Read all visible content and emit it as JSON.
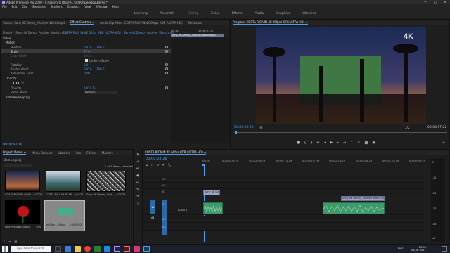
{
  "window": {
    "title": "Adobe Premiere Pro 2020 - C:\\Users\\FR DIGITAL SUTRA\\Desktop\\Demo *",
    "controls": [
      "—",
      "□",
      "✕"
    ]
  },
  "menu": [
    "File",
    "Edit",
    "Clip",
    "Sequence",
    "Markers",
    "Graphics",
    "View",
    "Window",
    "Help"
  ],
  "workspaces": {
    "items": [
      "Learning",
      "Assembly",
      "Editing",
      "Color",
      "Effects",
      "Audio",
      "Graphics",
      "Libraries"
    ],
    "active": "Editing"
  },
  "source_header": {
    "tabs": [
      "Source: Sony 4K Demo_ Another World.mp4",
      "Effect Controls ≡",
      "Audio Clip Mixer: COSTA RICA IN 4K 60fps HDR (ULTRA HD)",
      "Metadata"
    ]
  },
  "effect_controls": {
    "master": "Master * Sony 4K Demo_ Another World.mp4",
    "clip": "COSTA RICA IN 4K 60fps HDR (ULTRA HD) * Sony 4K Demo_ Another World.mp4",
    "timecode_start": "00:00",
    "timecode_end": "00:00:12:0",
    "clip_bar": "Sony 4K Demo_ Another World.mp4",
    "video_label": "Video",
    "motion": "Motion",
    "position_label": "Position",
    "position_x": "640.0",
    "position_y": "360.0",
    "scale_label": "Scale",
    "scale_value": "97.0",
    "scale_width_label": "Scale Width",
    "scale_width_value": "100.0",
    "uniform_label": "Uniform Scale",
    "rotation_label": "Rotation",
    "rotation_value": "0.0",
    "anchor_label": "Anchor Point",
    "anchor_x": "640.0",
    "anchor_y": "360.0",
    "flicker_label": "Anti-flicker Filter",
    "flicker_value": "0.00",
    "opacity": "Opacity",
    "opacity_label": "Opacity",
    "opacity_value": "100.0 %",
    "blend_label": "Blend Mode",
    "blend_value": "Normal",
    "time_remap": "Time Remapping",
    "timecode_bottom": "00:00:03:26"
  },
  "program": {
    "title": "Program: COSTA RICA IN 4K 60fps HDR (ULTRA HD) ≡",
    "timecode": "00:00:03:26",
    "fit": "Fit",
    "quality": "1/2",
    "duration": "00:04:07:22",
    "watermark": "4K"
  },
  "project": {
    "tabs": [
      "Project: Demo ≡",
      "Media Browser",
      "Libraries",
      "Info",
      "Effects",
      "Markers"
    ],
    "file": "Demo.prproj",
    "selected": "1 of 5 items selected",
    "items": [
      {
        "name": "COSTA RICA IN 4K 60",
        "dur": "4:07:22"
      },
      {
        "name": "COSTA RICA IN 4K 60",
        "dur": "4:07:22"
      },
      {
        "name": "Sony 4K Demo_ Anot",
        "dur": "4:04:24"
      },
      {
        "name": "rose_PNG66150.png",
        "dur": "5:00"
      },
      {
        "name": "YouTube ... Video",
        "dur": "2:59:00000"
      }
    ]
  },
  "timeline": {
    "title": "COSTA RICA IN 4K 60fps HDR (ULTRA HD) ≡",
    "timecode": "00:00:03:26",
    "ruler": [
      "00:00",
      "00:00:04:29",
      "00:00:09:29",
      "00:00:14:29",
      "00:00:19:29",
      "00:00:24:29",
      "00:00:29:29",
      "00:00:34:29",
      "00:00:39:29"
    ],
    "tracks_video": [
      "V3",
      "V2",
      "V1"
    ],
    "tracks_audio": [
      "A1",
      "A2",
      "A3"
    ],
    "src_v": "V1",
    "src_a": "A1",
    "audio_name": "Audio 1",
    "clip_v1_a": "Sony 4K De",
    "clip_v1_b": "Sony 4K Demo_ Another World.mp4",
    "meter_labels": [
      "0",
      "-12",
      "-24",
      "-36",
      "-48",
      "dB"
    ]
  },
  "taskbar": {
    "search": "Type here to search",
    "time": "13:58",
    "date": "08-06-2021",
    "lang": "ENG"
  }
}
